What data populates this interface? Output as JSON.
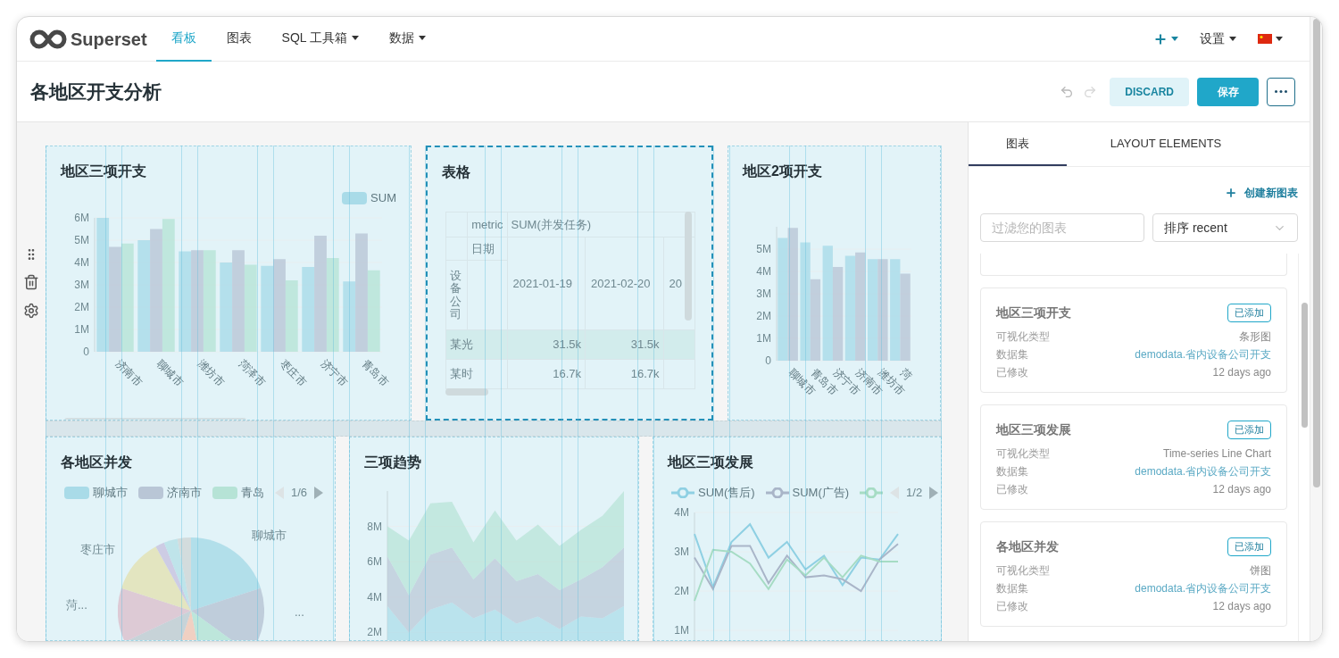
{
  "navbar": {
    "logo": "Superset",
    "menu": [
      {
        "label": "看板",
        "selected": true,
        "dropdown": false
      },
      {
        "label": "图表",
        "selected": false,
        "dropdown": false
      },
      {
        "label": "SQL 工具箱",
        "selected": false,
        "dropdown": true
      },
      {
        "label": "数据",
        "selected": false,
        "dropdown": true
      }
    ],
    "right_menu": [
      {
        "kind": "plus",
        "dropdown": true
      },
      {
        "kind": "text",
        "label": "设置",
        "dropdown": true
      },
      {
        "kind": "flag",
        "dropdown": true
      }
    ]
  },
  "header": {
    "title": "各地区开支分析",
    "discard": "DISCARD",
    "save": "保存"
  },
  "dashboard": {
    "rows": [
      {
        "charts": [
          {
            "kind": "bar",
            "title": "地区三项开支",
            "selected": false,
            "legend": [
              {
                "label": "SUM",
                "color": "#a9dbe8"
              }
            ],
            "chart_data": {
              "type": "bar",
              "categories": [
                "济南市",
                "聊城市",
                "潍坊市",
                "菏泽市",
                "枣庄市",
                "济宁市",
                "青岛市"
              ],
              "series": [
                {
                  "color": "#a9dbe8",
                  "values": [
                    6.0,
                    5.0,
                    4.5,
                    4.0,
                    3.85,
                    3.8,
                    3.15
                  ]
                },
                {
                  "color": "#b9c6d6",
                  "values": [
                    4.7,
                    5.5,
                    4.55,
                    4.55,
                    4.15,
                    5.2,
                    5.3
                  ]
                },
                {
                  "color": "#b6e3d6",
                  "values": [
                    4.85,
                    5.95,
                    4.55,
                    3.9,
                    3.2,
                    4.2,
                    3.65
                  ]
                }
              ],
              "ylim": [
                0,
                6
              ],
              "grid": true,
              "yticks": [
                {
                  "value": 0,
                  "label": "0"
                },
                {
                  "value": 1,
                  "label": "1M"
                },
                {
                  "value": 2,
                  "label": "2M"
                },
                {
                  "value": 3,
                  "label": "3M"
                },
                {
                  "value": 4,
                  "label": "4M"
                },
                {
                  "value": 5,
                  "label": "5M"
                },
                {
                  "value": 6,
                  "label": "6M"
                }
              ]
            }
          },
          {
            "kind": "table",
            "title": "表格",
            "selected": true,
            "metric_label": "metric",
            "metric": "SUM(并发任务)",
            "column_label": "日期",
            "row_label": "设备公司",
            "columns": [
              "2021-01-19",
              "2021-02-20",
              "20"
            ],
            "rows": [
              {
                "label": "某光",
                "cells": [
                  "31.5k",
                  "31.5k"
                ],
                "selected": true
              },
              {
                "label": "某时",
                "cells": [
                  "16.7k",
                  "16.7k"
                ],
                "selected": false
              }
            ]
          },
          {
            "kind": "bar",
            "title": "地区2项开支",
            "selected": false,
            "chart_data": {
              "type": "bar",
              "categories": [
                "聊城市",
                "青岛市",
                "济宁市",
                "济南市",
                "潍坊市",
                "菏"
              ],
              "series": [
                {
                  "color": "#a9dbe8",
                  "values": [
                    5.5,
                    5.3,
                    5.15,
                    4.7,
                    4.55,
                    4.55
                  ]
                },
                {
                  "color": "#b9c6d6",
                  "values": [
                    5.95,
                    3.65,
                    4.2,
                    4.85,
                    4.55,
                    3.9
                  ]
                }
              ],
              "ylim": [
                0,
                6
              ],
              "grid": true,
              "yticks": [
                {
                  "value": 0,
                  "label": "0"
                },
                {
                  "value": 1,
                  "label": "1M"
                },
                {
                  "value": 2,
                  "label": "2M"
                },
                {
                  "value": 3,
                  "label": "3M"
                },
                {
                  "value": 4,
                  "label": "4M"
                },
                {
                  "value": 5,
                  "label": "5M"
                }
              ]
            }
          }
        ]
      },
      {
        "charts": [
          {
            "kind": "pie",
            "title": "各地区并发",
            "selected": false,
            "legend": [
              {
                "label": "聊城市",
                "color": "#a9dbe8"
              },
              {
                "label": "济南市",
                "color": "#b9c6d6"
              },
              {
                "label": "青岛",
                "color": "#b6e3d6"
              }
            ],
            "pager": "1/6",
            "slice_labels": [
              "聊城市",
              "枣庄市",
              "菏...",
              "..."
            ]
          },
          {
            "kind": "area",
            "title": "三项趋势",
            "selected": false,
            "chart_data": {
              "type": "area",
              "stacked": true,
              "series": [
                {
                  "color": "#a9dbe8",
                  "values": [
                    3.5,
                    2.0,
                    3.3,
                    3.7,
                    2.8,
                    3.3,
                    2.5,
                    2.9,
                    2.2,
                    2.9,
                    2.8,
                    3.5
                  ]
                },
                {
                  "color": "#b9c6d6",
                  "values": [
                    2.8,
                    2.1,
                    3.1,
                    3.1,
                    2.2,
                    2.9,
                    2.4,
                    2.4,
                    2.2,
                    2.1,
                    2.9,
                    3.3
                  ]
                },
                {
                  "color": "#b6e3d6",
                  "values": [
                    1.7,
                    3.1,
                    2.9,
                    2.6,
                    2.1,
                    2.7,
                    2.3,
                    2.8,
                    2.5,
                    2.8,
                    2.9,
                    3.2
                  ]
                }
              ],
              "ylim": [
                0,
                10
              ],
              "grid": true,
              "yticks": [
                {
                  "value": 2,
                  "label": "2M"
                },
                {
                  "value": 4,
                  "label": "4M"
                },
                {
                  "value": 6,
                  "label": "6M"
                },
                {
                  "value": 8,
                  "label": "8M"
                }
              ]
            }
          },
          {
            "kind": "line",
            "title": "地区三项发展",
            "selected": false,
            "legend": [
              {
                "label": "SUM(售后)",
                "color": "#8fd0e3"
              },
              {
                "label": "SUM(广告)",
                "color": "#a9b5c8"
              },
              {
                "color": "#a6dcc4"
              }
            ],
            "pager": "1/2",
            "chart_data": {
              "type": "line",
              "series": [
                {
                  "color": "#8fd0e3",
                  "values": [
                    3.45,
                    2.1,
                    3.25,
                    3.7,
                    2.85,
                    3.25,
                    2.55,
                    2.9,
                    2.15,
                    2.85,
                    2.8,
                    3.45
                  ]
                },
                {
                  "color": "#a9b5c8",
                  "values": [
                    2.85,
                    2.05,
                    3.15,
                    3.15,
                    2.2,
                    2.9,
                    2.35,
                    2.4,
                    2.3,
                    2.0,
                    2.8,
                    3.2
                  ]
                },
                {
                  "color": "#a6dcc4",
                  "values": [
                    1.75,
                    3.05,
                    3.0,
                    2.7,
                    2.05,
                    2.8,
                    2.4,
                    2.85,
                    2.35,
                    2.9,
                    2.75,
                    2.75
                  ]
                }
              ],
              "ylim": [
                0,
                4
              ],
              "grid": true,
              "yticks": [
                {
                  "value": 1,
                  "label": "1M"
                },
                {
                  "value": 2,
                  "label": "2M"
                },
                {
                  "value": 3,
                  "label": "3M"
                },
                {
                  "value": 4,
                  "label": "4M"
                }
              ]
            }
          }
        ]
      }
    ]
  },
  "panel": {
    "tabs": [
      {
        "label": "图表",
        "selected": true
      },
      {
        "label": "LAYOUT ELEMENTS",
        "selected": false
      }
    ],
    "create": "创建新图表",
    "filter_placeholder": "过滤您的图表",
    "sort": "排序 recent",
    "cards": [
      {
        "title": "地区三项开支",
        "badge": "已添加",
        "rows": [
          {
            "label": "可视化类型",
            "value": "条形图",
            "link": false
          },
          {
            "label": "数据集",
            "value": "demodata.省内设备公司开支",
            "link": true
          },
          {
            "label": "已修改",
            "value": "12 days ago",
            "link": false
          }
        ]
      },
      {
        "title": "地区三项发展",
        "badge": "已添加",
        "rows": [
          {
            "label": "可视化类型",
            "value": "Time-series Line Chart",
            "link": false
          },
          {
            "label": "数据集",
            "value": "demodata.省内设备公司开支",
            "link": true
          },
          {
            "label": "已修改",
            "value": "12 days ago",
            "link": false
          }
        ]
      },
      {
        "title": "各地区并发",
        "badge": "已添加",
        "rows": [
          {
            "label": "可视化类型",
            "value": "饼图",
            "link": false
          },
          {
            "label": "数据集",
            "value": "demodata.省内设备公司开支",
            "link": true
          },
          {
            "label": "已修改",
            "value": "12 days ago",
            "link": false
          }
        ]
      }
    ]
  }
}
